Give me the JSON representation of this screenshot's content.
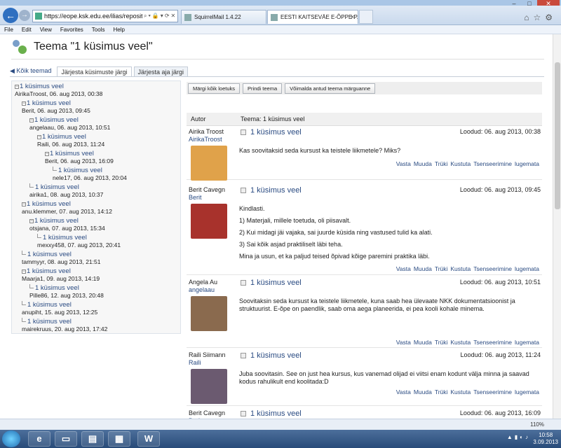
{
  "browser": {
    "address_url": "https://eope.ksk.edu.ee/ilias/repository.ph",
    "tabs": [
      {
        "label": "SquirrelMail 1.4.22"
      },
      {
        "label": "EESTI KAITSEVÄE E-ÕPPE P..."
      }
    ],
    "menu": [
      "File",
      "Edit",
      "View",
      "Favorites",
      "Tools",
      "Help"
    ],
    "zoom": "110%"
  },
  "page": {
    "title": "Teema \"1 küsimus veel\"",
    "back_link": "Kõik teemad",
    "tabs": [
      "Järjesta küsimuste järgi",
      "Järjesta aja järgi"
    ]
  },
  "tree": [
    {
      "title": "1 küsimus veel",
      "meta": "AirikaTroost, 06. aug 2013, 00:38"
    },
    {
      "title": "1 küsimus veel",
      "meta": "Berit, 06. aug 2013, 09:45"
    },
    {
      "title": "1 küsimus veel",
      "meta": "angelaau, 06. aug 2013, 10:51"
    },
    {
      "title": "1 küsimus veel",
      "meta": "Raili, 06. aug 2013, 11:24"
    },
    {
      "title": "1 küsimus veel",
      "meta": "Berit, 06. aug 2013, 16:09"
    },
    {
      "title": "1 küsimus veel",
      "meta": "nele17, 06. aug 2013, 20:04"
    },
    {
      "title": "1 küsimus veel",
      "meta": "airika1, 08. aug 2013, 10:37"
    },
    {
      "title": "1 küsimus veel",
      "meta": "anu.klemmer, 07. aug 2013, 14:12"
    },
    {
      "title": "1 küsimus veel",
      "meta": "otsjana, 07. aug 2013, 15:34"
    },
    {
      "title": "1 küsimus veel",
      "meta": "mexxy458, 07. aug 2013, 20:41"
    },
    {
      "title": "1 küsimus veel",
      "meta": "tammyyr, 08. aug 2013, 21:51"
    },
    {
      "title": "1 küsimus veel",
      "meta": "Maarja1, 09. aug 2013, 14:19"
    },
    {
      "title": "1 küsimus veel",
      "meta": "Pille86, 12. aug 2013, 20:48"
    },
    {
      "title": "1 küsimus veel",
      "meta": "anupiht, 15. aug 2013, 12:25"
    },
    {
      "title": "1 küsimus veel",
      "meta": "mairekruus, 20. aug 2013, 17:42"
    }
  ],
  "actions": [
    "Märgi kõik loetuks",
    "Prindi teema",
    "Võimalda antud teema märguanne"
  ],
  "table_header": {
    "author": "Autor",
    "topic": "Teema: 1 küsimus veel"
  },
  "post_actions": [
    "Vasta",
    "Muuda",
    "Trüki",
    "Kustuta",
    "Tsenseerimine",
    "lugemata"
  ],
  "posts": [
    {
      "name": "Airika Troost",
      "login": "AirikaTroost",
      "title": "1 küsimus veel",
      "created": "Loodud: 06. aug 2013, 00:38",
      "body": [
        "Kas soovitaksid seda kursust ka teistele liikmetele? Miks?"
      ],
      "avatar_color": "#e0a24a"
    },
    {
      "name": "Berit Cavegn",
      "login": "Berit",
      "title": "1 küsimus veel",
      "created": "Loodud: 06. aug 2013, 09:45",
      "body": [
        "Kindlasti.",
        "1) Materjali, millele toetuda, oli piisavalt.",
        "2) Kui midagi jäi vajaka, sai juurde küsida ning vastused tulid ka alati.",
        "3) Sai kõik asjad praktiliselt läbi teha.",
        "Mina ja usun, et ka paljud teised õpivad kõige paremini praktika läbi."
      ],
      "avatar_color": "#a8322c"
    },
    {
      "name": "Angela Au",
      "login": "angelaau",
      "title": "1 küsimus veel",
      "created": "Loodud: 06. aug 2013, 10:51",
      "body": [
        "Soovitaksin seda kursust ka teistele liikmetele, kuna saab hea ülevaate NKK dokumentatsioonist ja struktuurist. E-õpe on paendlik, saab oma aega planeerida, ei pea kooli kohale minema."
      ],
      "avatar_color": "#8a6a4e"
    },
    {
      "name": "Raili Siimann",
      "login": "Raili",
      "title": "1 küsimus veel",
      "created": "Loodud: 06. aug 2013, 11:24",
      "body": [
        "Juba soovitasin. See on just hea kursus, kus vanemad olijad ei viitsi enam kodunt välja minna ja saavad kodus rahulikult end koolitada:D"
      ],
      "avatar_color": "#6b5a70"
    },
    {
      "name": "Berit Cavegn",
      "login": "Berit",
      "title": "1 küsimus veel",
      "created": "Loodud: 06. aug 2013, 16:09",
      "body": [],
      "avatar_color": "#a8322c"
    }
  ],
  "clock": {
    "time": "10:58",
    "date": "3.09.2013"
  }
}
